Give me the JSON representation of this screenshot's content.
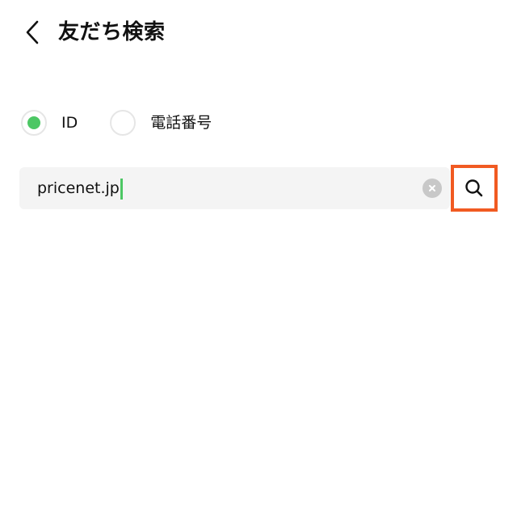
{
  "header": {
    "title": "友だち検索",
    "back_icon": "chevron-left-icon"
  },
  "search_type": {
    "options": [
      {
        "label": "ID",
        "selected": true
      },
      {
        "label": "電話番号",
        "selected": false
      }
    ],
    "accent_color": "#4cc764"
  },
  "search": {
    "value": "pricenet.jp",
    "clear_icon": "clear-icon",
    "search_icon": "search-icon",
    "highlight_color": "#f15a22"
  }
}
